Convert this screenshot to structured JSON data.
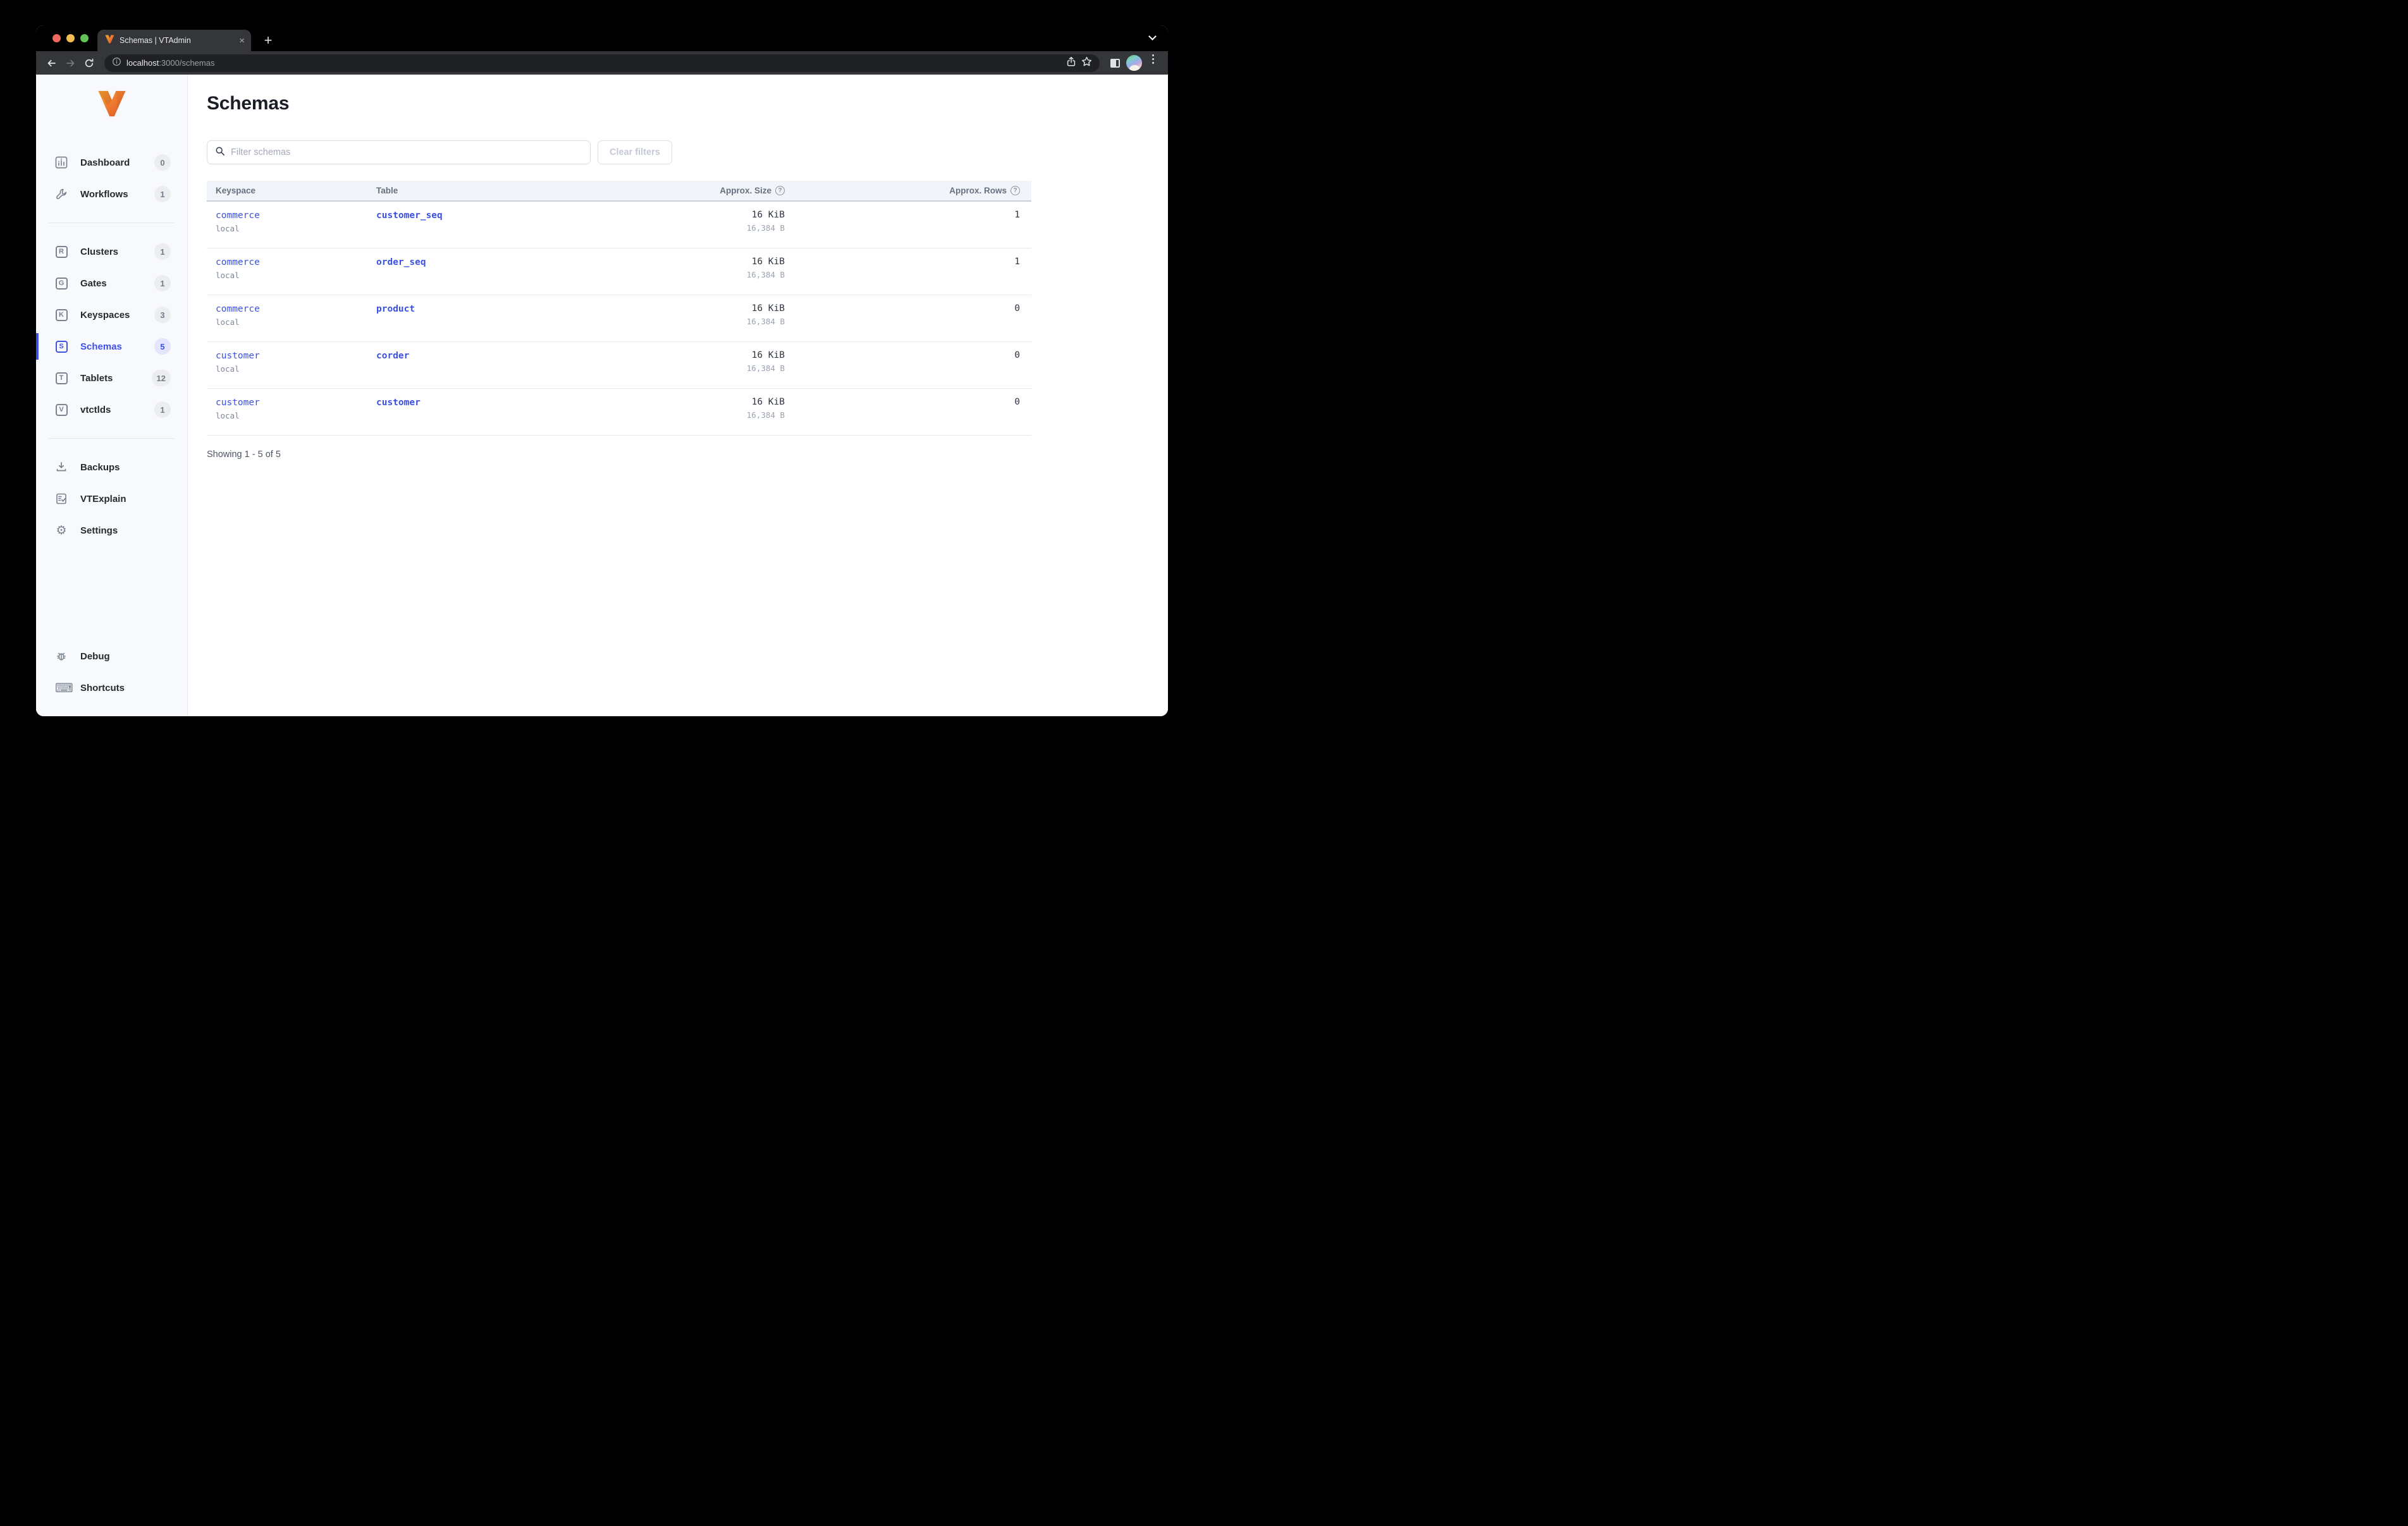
{
  "colors": {
    "accent": "#3D51E4",
    "link": "#3B51E3",
    "logo_orange_light": "#F6A82C",
    "logo_orange_dark": "#D9542B",
    "traffic_red": "#EE6A5E",
    "traffic_yellow": "#F5BD4F",
    "traffic_green": "#61C455",
    "chrome_dark": "#35363A",
    "omnibox_dark": "#202124",
    "sidebar_bg": "#F8F9FC"
  },
  "browser": {
    "tab_title": "Schemas | VTAdmin",
    "tab_favicon": "vitess-logo-icon",
    "close_glyph": "×",
    "new_tab_glyph": "+",
    "url_host": "localhost",
    "url_rest": ":3000/schemas",
    "toolbar_icons": [
      "back-arrow-icon",
      "forward-arrow-icon",
      "reload-icon",
      "info-icon",
      "share-icon",
      "star-icon",
      "side-panel-icon",
      "profile-avatar",
      "kebab-menu-icon"
    ]
  },
  "sidebar": {
    "groups": [
      [
        {
          "label": "Dashboard",
          "count": "0",
          "icon": "dashboard-icon"
        },
        {
          "label": "Workflows",
          "count": "1",
          "icon": "wrench-icon"
        }
      ],
      [
        {
          "label": "Clusters",
          "count": "1",
          "icon": "letter-icon",
          "letter": "R"
        },
        {
          "label": "Gates",
          "count": "1",
          "icon": "letter-icon",
          "letter": "G"
        },
        {
          "label": "Keyspaces",
          "count": "3",
          "icon": "letter-icon",
          "letter": "K"
        },
        {
          "label": "Schemas",
          "count": "5",
          "icon": "letter-icon",
          "letter": "S",
          "active": true
        },
        {
          "label": "Tablets",
          "count": "12",
          "icon": "letter-icon",
          "letter": "T"
        },
        {
          "label": "vtctlds",
          "count": "1",
          "icon": "letter-icon",
          "letter": "V"
        }
      ],
      [
        {
          "label": "Backups",
          "icon": "download-icon"
        },
        {
          "label": "VTExplain",
          "icon": "checklist-doc-icon"
        },
        {
          "label": "Settings",
          "icon": "gear-icon"
        }
      ]
    ],
    "bottom": [
      {
        "label": "Debug",
        "icon": "bug-icon"
      },
      {
        "label": "Shortcuts",
        "icon": "keyboard-icon"
      }
    ]
  },
  "main": {
    "title": "Schemas",
    "filter_placeholder": "Filter schemas",
    "filter_value": "",
    "clear_button": "Clear filters",
    "table": {
      "headers": {
        "keyspace": "Keyspace",
        "table": "Table",
        "size": "Approx. Size",
        "rows": "Approx. Rows"
      },
      "rows": [
        {
          "keyspace": "commerce",
          "cluster": "local",
          "table": "customer_seq",
          "size": "16 KiB",
          "size_bytes": "16,384 B",
          "approx_rows": "1"
        },
        {
          "keyspace": "commerce",
          "cluster": "local",
          "table": "order_seq",
          "size": "16 KiB",
          "size_bytes": "16,384 B",
          "approx_rows": "1"
        },
        {
          "keyspace": "commerce",
          "cluster": "local",
          "table": "product",
          "size": "16 KiB",
          "size_bytes": "16,384 B",
          "approx_rows": "0"
        },
        {
          "keyspace": "customer",
          "cluster": "local",
          "table": "corder",
          "size": "16 KiB",
          "size_bytes": "16,384 B",
          "approx_rows": "0"
        },
        {
          "keyspace": "customer",
          "cluster": "local",
          "table": "customer",
          "size": "16 KiB",
          "size_bytes": "16,384 B",
          "approx_rows": "0"
        }
      ]
    },
    "showing": "Showing 1 - 5 of 5"
  }
}
